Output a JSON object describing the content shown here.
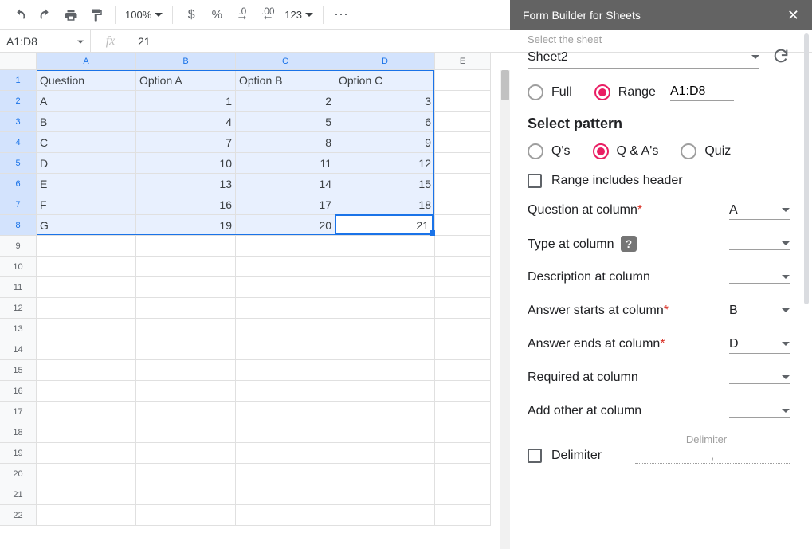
{
  "toolbar": {
    "zoom": "100%"
  },
  "namebox": "A1:D8",
  "formula": "21",
  "columns": [
    "A",
    "B",
    "C",
    "D",
    "E"
  ],
  "selected_cols": 4,
  "selected_rows": 8,
  "active": {
    "row": 8,
    "col": 4
  },
  "rows": [
    {
      "h": "1",
      "cells": [
        "Question",
        "Option A",
        "Option B",
        "Option C",
        ""
      ],
      "types": [
        "t",
        "t",
        "t",
        "t",
        "t"
      ]
    },
    {
      "h": "2",
      "cells": [
        "A",
        "1",
        "2",
        "3",
        ""
      ],
      "types": [
        "t",
        "n",
        "n",
        "n",
        "t"
      ]
    },
    {
      "h": "3",
      "cells": [
        "B",
        "4",
        "5",
        "6",
        ""
      ],
      "types": [
        "t",
        "n",
        "n",
        "n",
        "t"
      ]
    },
    {
      "h": "4",
      "cells": [
        "C",
        "7",
        "8",
        "9",
        ""
      ],
      "types": [
        "t",
        "n",
        "n",
        "n",
        "t"
      ]
    },
    {
      "h": "5",
      "cells": [
        "D",
        "10",
        "11",
        "12",
        ""
      ],
      "types": [
        "t",
        "n",
        "n",
        "n",
        "t"
      ]
    },
    {
      "h": "6",
      "cells": [
        "E",
        "13",
        "14",
        "15",
        ""
      ],
      "types": [
        "t",
        "n",
        "n",
        "n",
        "t"
      ]
    },
    {
      "h": "7",
      "cells": [
        "F",
        "16",
        "17",
        "18",
        ""
      ],
      "types": [
        "t",
        "n",
        "n",
        "n",
        "t"
      ]
    },
    {
      "h": "8",
      "cells": [
        "G",
        "19",
        "20",
        "21",
        ""
      ],
      "types": [
        "t",
        "n",
        "n",
        "n",
        "t"
      ]
    },
    {
      "h": "9",
      "cells": [
        "",
        "",
        "",
        "",
        ""
      ],
      "types": [
        "t",
        "t",
        "t",
        "t",
        "t"
      ]
    },
    {
      "h": "10",
      "cells": [
        "",
        "",
        "",
        "",
        ""
      ],
      "types": [
        "t",
        "t",
        "t",
        "t",
        "t"
      ]
    },
    {
      "h": "11",
      "cells": [
        "",
        "",
        "",
        "",
        ""
      ],
      "types": [
        "t",
        "t",
        "t",
        "t",
        "t"
      ]
    },
    {
      "h": "12",
      "cells": [
        "",
        "",
        "",
        "",
        ""
      ],
      "types": [
        "t",
        "t",
        "t",
        "t",
        "t"
      ]
    },
    {
      "h": "13",
      "cells": [
        "",
        "",
        "",
        "",
        ""
      ],
      "types": [
        "t",
        "t",
        "t",
        "t",
        "t"
      ]
    },
    {
      "h": "14",
      "cells": [
        "",
        "",
        "",
        "",
        ""
      ],
      "types": [
        "t",
        "t",
        "t",
        "t",
        "t"
      ]
    },
    {
      "h": "15",
      "cells": [
        "",
        "",
        "",
        "",
        ""
      ],
      "types": [
        "t",
        "t",
        "t",
        "t",
        "t"
      ]
    },
    {
      "h": "16",
      "cells": [
        "",
        "",
        "",
        "",
        ""
      ],
      "types": [
        "t",
        "t",
        "t",
        "t",
        "t"
      ]
    },
    {
      "h": "17",
      "cells": [
        "",
        "",
        "",
        "",
        ""
      ],
      "types": [
        "t",
        "t",
        "t",
        "t",
        "t"
      ]
    },
    {
      "h": "18",
      "cells": [
        "",
        "",
        "",
        "",
        ""
      ],
      "types": [
        "t",
        "t",
        "t",
        "t",
        "t"
      ]
    },
    {
      "h": "19",
      "cells": [
        "",
        "",
        "",
        "",
        ""
      ],
      "types": [
        "t",
        "t",
        "t",
        "t",
        "t"
      ]
    },
    {
      "h": "20",
      "cells": [
        "",
        "",
        "",
        "",
        ""
      ],
      "types": [
        "t",
        "t",
        "t",
        "t",
        "t"
      ]
    },
    {
      "h": "21",
      "cells": [
        "",
        "",
        "",
        "",
        ""
      ],
      "types": [
        "t",
        "t",
        "t",
        "t",
        "t"
      ]
    },
    {
      "h": "22",
      "cells": [
        "",
        "",
        "",
        "",
        ""
      ],
      "types": [
        "t",
        "t",
        "t",
        "t",
        "t"
      ]
    }
  ],
  "sidebar": {
    "title": "Form Builder for Sheets",
    "sheet_lbl": "Select the sheet",
    "sheet_val": "Sheet2",
    "mode_full": "Full",
    "mode_range": "Range",
    "range_val": "A1:D8",
    "pattern_title": "Select pattern",
    "pattern_qs": "Q's",
    "pattern_qa": "Q & A's",
    "pattern_quiz": "Quiz",
    "include_header": "Range includes header",
    "question_col_lbl": "Question at column",
    "question_col_val": "A",
    "type_col_lbl": "Type at column",
    "desc_col_lbl": "Description at column",
    "ans_start_lbl": "Answer starts at column",
    "ans_start_val": "B",
    "ans_end_lbl": "Answer ends at column",
    "ans_end_val": "D",
    "required_lbl": "Required at column",
    "addother_lbl": "Add other at column",
    "delimiter_title": "Delimiter",
    "delimiter_lbl": "Delimiter",
    "delimiter_val": ","
  }
}
